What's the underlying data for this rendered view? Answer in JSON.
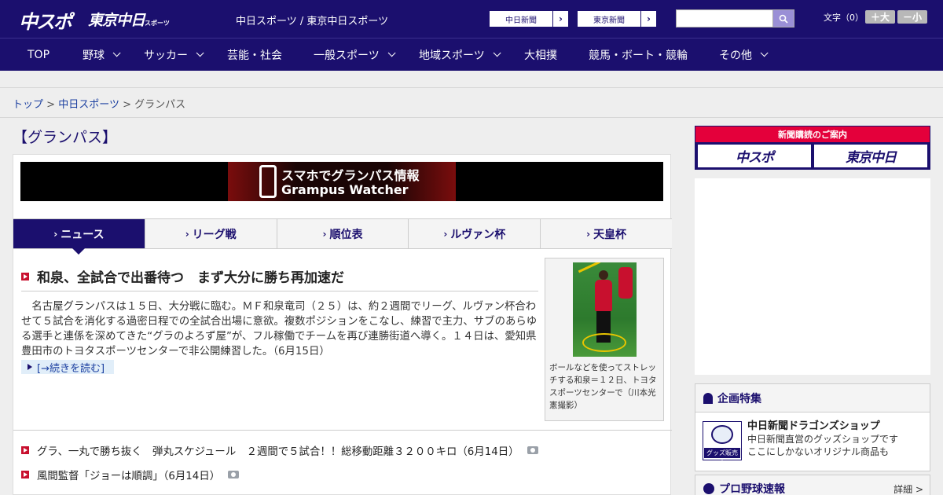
{
  "header": {
    "logo_chuspo": "中スポ",
    "logo_tokyo": "東京中日",
    "logo_tokyo_sub": "スポーツ",
    "site_name": "中日スポーツ / 東京中日スポーツ",
    "links": [
      {
        "label": "中日新聞"
      },
      {
        "label": "東京新聞"
      }
    ],
    "search_value": "",
    "fontsize_label": "文字（0）",
    "font_up": "＋大",
    "font_down": "－小"
  },
  "nav": {
    "items": [
      {
        "label": "TOP"
      },
      {
        "label": "野球"
      },
      {
        "label": "サッカー"
      },
      {
        "label": "芸能・社会"
      },
      {
        "label": "一般スポーツ"
      },
      {
        "label": "地域スポーツ"
      },
      {
        "label": "大相撲"
      },
      {
        "label": "競馬・ボート・競輪"
      },
      {
        "label": "その他"
      }
    ]
  },
  "breadcrumb": {
    "home": "トップ",
    "sep": ">",
    "section": "中日スポーツ",
    "current": "グランパス"
  },
  "page_title": "【グランパス】",
  "promo": {
    "line1": "スマホでグランパス情報",
    "line2": "Grampus Watcher"
  },
  "tabs": [
    {
      "label": "ニュース",
      "active": true
    },
    {
      "label": "リーグ戦",
      "active": false
    },
    {
      "label": "順位表",
      "active": false
    },
    {
      "label": "ルヴァン杯",
      "active": false
    },
    {
      "label": "天皇杯",
      "active": false
    }
  ],
  "article": {
    "headline": "和泉、全試合で出番待つ　まず大分に勝ち再加速だ",
    "body": "　名古屋グランパスは１５日、大分戦に臨む。ＭＦ和泉竜司（２５）は、約２週間でリーグ、ルヴァン杯合わせて５試合を消化する過密日程での全試合出場に意欲。複数ポジションをこなし、練習で主力、サブのあらゆる選手と連係を深めてきた“グラのよろず屋”が、フル稼働でチームを再び連勝街道へ導く。１４日は、愛知県豊田市のトヨタスポーツセンターで非公開練習した。（6月15日）",
    "read_more": "[→続きを読む]",
    "photo_caption": "ボールなどを使ってストレッチする和泉＝１２日、トヨタスポーツセンターで（川本光憲撮影）"
  },
  "news_list": [
    {
      "text": "グラ、一丸で勝ち抜く　弾丸スケジュール　２週間で５試合！！総移動距離３２００キロ（6月14日）",
      "has_photo": true
    },
    {
      "text": "風間監督「ジョーは順調」（6月14日）",
      "has_photo": true
    }
  ],
  "sidebar": {
    "subscribe_title": "新聞購読のご案内",
    "subscribe_btn1": "中スポ",
    "subscribe_btn2": "東京中日",
    "feature_title": "企画特集",
    "shop_title": "中日新聞ドラゴンズショップ",
    "shop_desc1": "中日新聞直営のグッズショップです",
    "shop_desc2": "ここにしかないオリジナル商品も",
    "shop_tag": "グッズ販売中",
    "baseball_title": "プロ野球速報",
    "baseball_more": "詳細 >"
  }
}
